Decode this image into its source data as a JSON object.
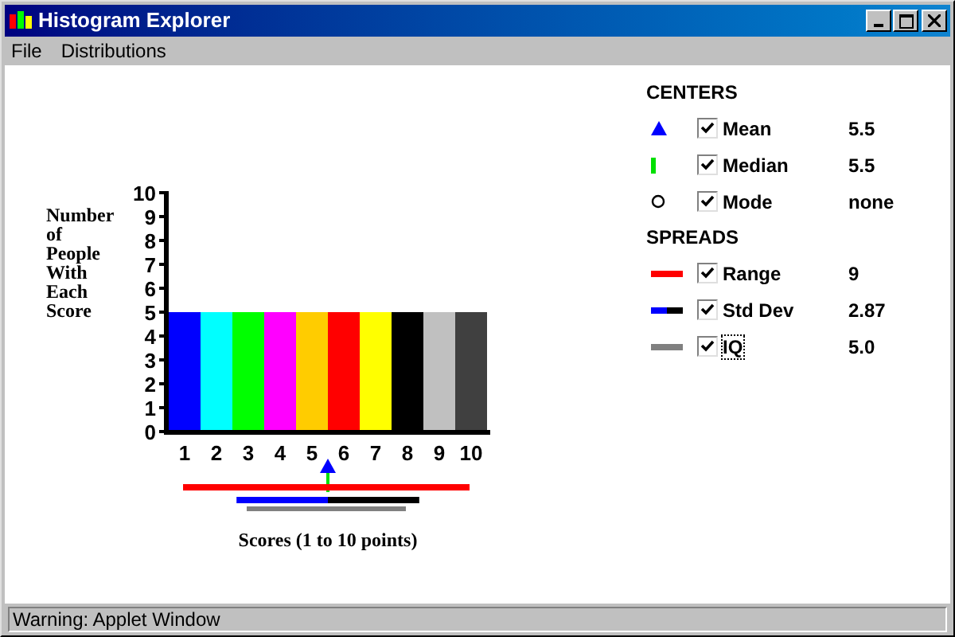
{
  "window": {
    "title": "Histogram Explorer"
  },
  "menu": [
    "File",
    "Distributions"
  ],
  "chart": {
    "bars": [
      {
        "color": "#0000ff"
      },
      {
        "color": "#00ffff"
      },
      {
        "color": "#00ff00"
      },
      {
        "color": "#ff00ff"
      },
      {
        "color": "#ffcc00"
      },
      {
        "color": "#ff0000"
      },
      {
        "color": "#ffff00"
      },
      {
        "color": "#000000"
      },
      {
        "color": "#c0c0c0"
      },
      {
        "color": "#404040"
      }
    ],
    "chart_data": {
      "type": "bar",
      "xlabel": "Scores (1 to 10 points)",
      "ylabel": "Number of People With Each Score",
      "categories": [
        "1",
        "2",
        "3",
        "4",
        "5",
        "6",
        "7",
        "8",
        "9",
        "10"
      ],
      "values": [
        5,
        5,
        5,
        5,
        5,
        5,
        5,
        5,
        5,
        5
      ],
      "ylim": [
        0,
        10
      ],
      "yticks": [
        0,
        1,
        2,
        3,
        4,
        5,
        6,
        7,
        8,
        9,
        10
      ]
    }
  },
  "centers": {
    "heading": "CENTERS",
    "items": [
      {
        "kind": "triangle",
        "label": "Mean",
        "checked": true,
        "value": "5.5"
      },
      {
        "kind": "tick",
        "label": "Median",
        "checked": true,
        "value": "5.5"
      },
      {
        "kind": "circle",
        "label": "Mode",
        "checked": true,
        "value": "none"
      }
    ]
  },
  "spreads": {
    "heading": "SPREADS",
    "items": [
      {
        "kind": "range",
        "label": "Range",
        "checked": true,
        "value": "9"
      },
      {
        "kind": "stddev",
        "label": "Std Dev",
        "checked": true,
        "value": "2.87"
      },
      {
        "kind": "iq",
        "label": "IQ",
        "checked": true,
        "focused": true,
        "value": "5.0"
      }
    ]
  },
  "status_bar": "Warning: Applet Window"
}
